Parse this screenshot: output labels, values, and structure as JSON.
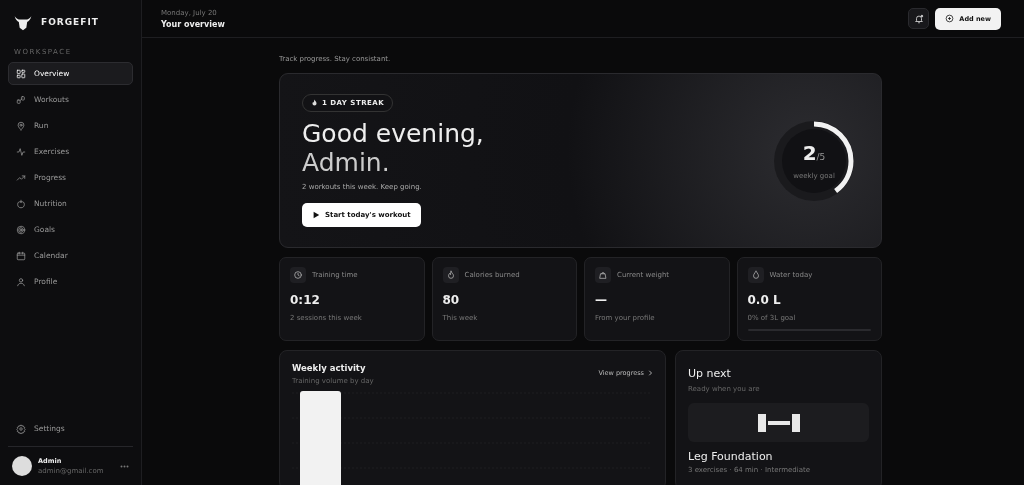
{
  "brand": {
    "name": "FORGEFIT"
  },
  "sidebar": {
    "section_label": "WORKSPACE",
    "items": [
      {
        "label": "Overview",
        "selected": true
      },
      {
        "label": "Workouts",
        "selected": false
      },
      {
        "label": "Run",
        "selected": false
      },
      {
        "label": "Exercises",
        "selected": false
      },
      {
        "label": "Progress",
        "selected": false
      },
      {
        "label": "Nutrition",
        "selected": false
      },
      {
        "label": "Goals",
        "selected": false
      },
      {
        "label": "Calendar",
        "selected": false
      },
      {
        "label": "Profile",
        "selected": false
      }
    ],
    "settings": {
      "label": "Settings"
    },
    "user": {
      "name": "Admin",
      "email": "admin@gmail.com"
    }
  },
  "header": {
    "date": "Monday, July 20",
    "title": "Your overview",
    "add_button": "Add new"
  },
  "tagline": "Track progress. Stay consistant.",
  "hero": {
    "streak": "1 DAY STREAK",
    "greeting": "Good evening,",
    "name": "Admin.",
    "subtitle": "2 workouts this week. Keep going.",
    "button": "Start today's workout",
    "goal": {
      "done": "2",
      "total": "/5",
      "label": "weekly goal",
      "level": 0.4
    }
  },
  "stats": [
    {
      "label": "Training time",
      "value": "0:12",
      "note": "2 sessions this week"
    },
    {
      "label": "Calories burned",
      "value": "80",
      "note": "This week"
    },
    {
      "label": "Current weight",
      "value": "—",
      "note": "From your profile"
    },
    {
      "label": "Water today",
      "value": "0.0 L",
      "note": "0% of 3L goal",
      "level": 0
    }
  ],
  "activity": {
    "title": "Weekly activity",
    "subtitle": "Training volume by day",
    "link": "View progress"
  },
  "up_next": {
    "title": "Up next",
    "subtitle": "Ready when you are",
    "workout": "Leg Foundation",
    "meta": "3 exercises · 64 min · Intermediate"
  }
}
